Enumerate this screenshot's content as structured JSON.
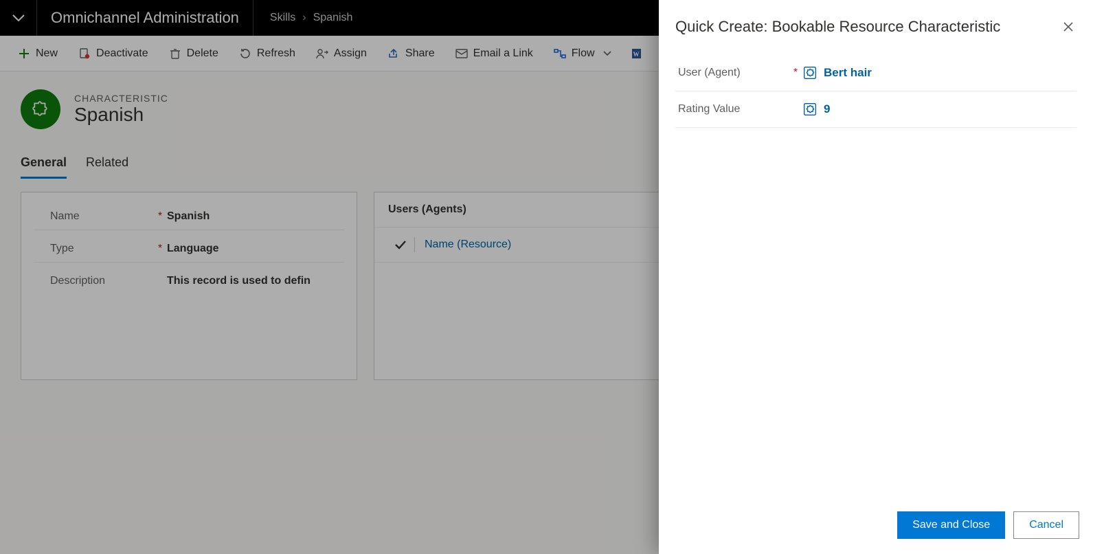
{
  "header": {
    "app_name": "Omnichannel Administration",
    "breadcrumb": [
      "Skills",
      "Spanish"
    ]
  },
  "commands": {
    "new": "New",
    "deactivate": "Deactivate",
    "delete": "Delete",
    "refresh": "Refresh",
    "assign": "Assign",
    "share": "Share",
    "email": "Email a Link",
    "flow": "Flow"
  },
  "record": {
    "kind": "CHARACTERISTIC",
    "title": "Spanish"
  },
  "tabs": {
    "general": "General",
    "related": "Related"
  },
  "form": {
    "name_label": "Name",
    "name_value": "Spanish",
    "type_label": "Type",
    "type_value": "Language",
    "desc_label": "Description",
    "desc_value": "This record is used to defin"
  },
  "grid": {
    "title": "Users (Agents)",
    "col_name": "Name (Resource)"
  },
  "flyout": {
    "title": "Quick Create: Bookable Resource Characteristic",
    "user_label": "User (Agent)",
    "user_value": "Bert hair",
    "rating_label": "Rating Value",
    "rating_value": "9",
    "save": "Save and Close",
    "cancel": "Cancel"
  }
}
